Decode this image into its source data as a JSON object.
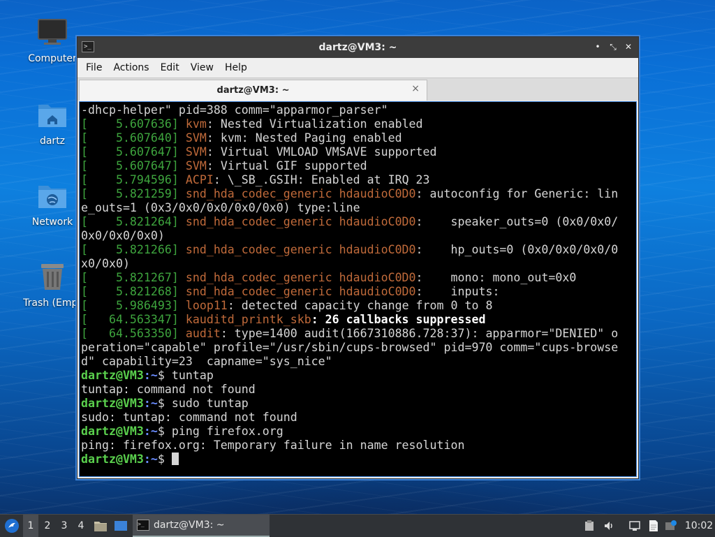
{
  "desktop": {
    "icons": [
      {
        "label": "Computer"
      },
      {
        "label": "dartz"
      },
      {
        "label": "Network"
      },
      {
        "label": "Trash (Empt"
      }
    ]
  },
  "window": {
    "title": "dartz@VM3: ~",
    "menu": [
      "File",
      "Actions",
      "Edit",
      "View",
      "Help"
    ],
    "tab_label": "dartz@VM3: ~",
    "tab_close": "×",
    "minimize": "•",
    "maximize": "⤡",
    "close": "✕"
  },
  "terminal": {
    "line0": "-dhcp-helper\" pid=388 comm=\"apparmor_parser\"",
    "k1": {
      "ts": "[    5.607636] ",
      "src": "kvm",
      "msg": ": Nested Virtualization enabled"
    },
    "k2": {
      "ts": "[    5.607640] ",
      "src": "SVM",
      "msg": ": kvm: Nested Paging enabled"
    },
    "k3": {
      "ts": "[    5.607647] ",
      "src": "SVM",
      "msg": ": Virtual VMLOAD VMSAVE supported"
    },
    "k4": {
      "ts": "[    5.607647] ",
      "src": "SVM",
      "msg": ": Virtual GIF supported"
    },
    "k5": {
      "ts": "[    5.794596] ",
      "src": "ACPI",
      "msg": ": \\_SB_.GSIH: Enabled at IRQ 23"
    },
    "k6": {
      "ts": "[    5.821259] ",
      "src": "snd_hda_codec_generic hdaudioC0D0",
      "msg": ": autoconfig for Generic: lin"
    },
    "k6b": "e_outs=1 (0x3/0x0/0x0/0x0/0x0) type:line",
    "k7": {
      "ts": "[    5.821264] ",
      "src": "snd_hda_codec_generic hdaudioC0D0",
      "msg": ":    speaker_outs=0 (0x0/0x0/"
    },
    "k7b": "0x0/0x0/0x0)",
    "k8": {
      "ts": "[    5.821266] ",
      "src": "snd_hda_codec_generic hdaudioC0D0",
      "msg": ":    hp_outs=0 (0x0/0x0/0x0/0"
    },
    "k8b": "x0/0x0)",
    "k9": {
      "ts": "[    5.821267] ",
      "src": "snd_hda_codec_generic hdaudioC0D0",
      "msg": ":    mono: mono_out=0x0"
    },
    "k10": {
      "ts": "[    5.821268] ",
      "src": "snd_hda_codec_generic hdaudioC0D0",
      "msg": ":    inputs:"
    },
    "k11": {
      "ts": "[    5.986493] ",
      "src": "loop11",
      "msg": ": detected capacity change from 0 to 8"
    },
    "k12": {
      "ts": "[   64.563347] ",
      "src": "kauditd_printk_skb",
      "msg": ": 26 callbacks suppressed"
    },
    "k13": {
      "ts": "[   64.563350] ",
      "src": "audit",
      "msg": ": type=1400 audit(1667310886.728:37): apparmor=\"DENIED\" o"
    },
    "k13b": "peration=\"capable\" profile=\"/usr/sbin/cups-browsed\" pid=970 comm=\"cups-browse",
    "k13c": "d\" capability=23  capname=\"sys_nice\"",
    "prompt_user": "dartz@VM3",
    "prompt_path": ":~",
    "prompt_sign": "$ ",
    "cmd1": "tuntap",
    "out1": "tuntap: command not found",
    "cmd2": "sudo tuntap",
    "out2": "sudo: tuntap: command not found",
    "cmd3": "ping firefox.org",
    "out3": "ping: firefox.org: Temporary failure in name resolution"
  },
  "taskbar": {
    "workspaces": [
      "1",
      "2",
      "3",
      "4"
    ],
    "task_label": "dartz@VM3: ~",
    "clock": "10:02"
  }
}
